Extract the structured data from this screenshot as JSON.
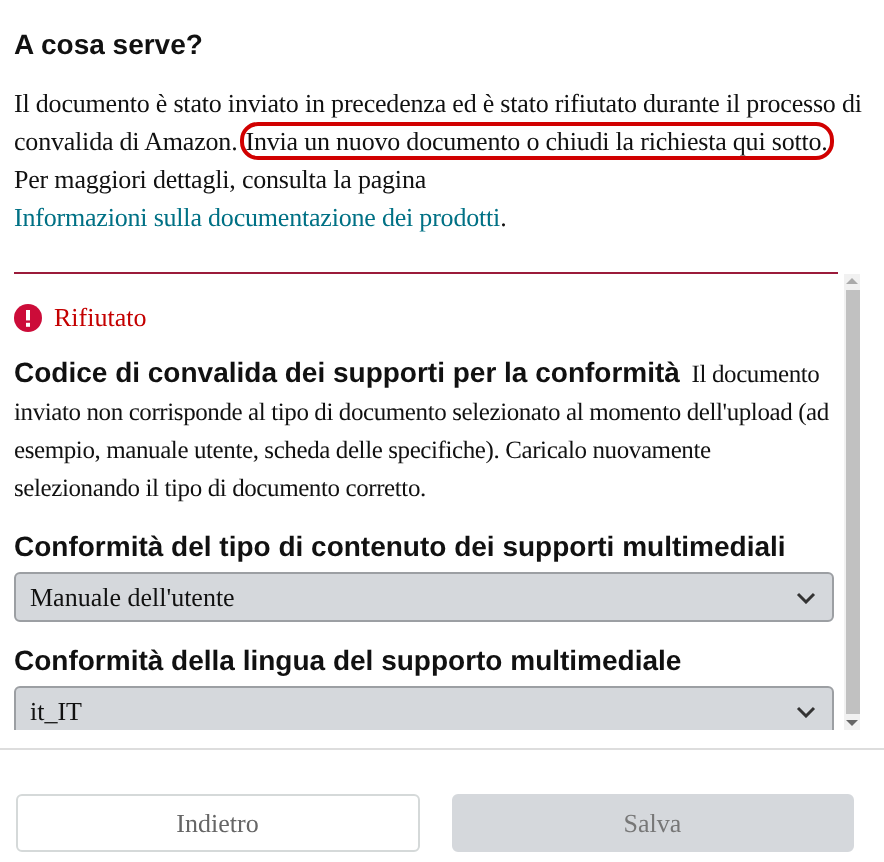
{
  "heading": "A cosa serve?",
  "intro": [
    {
      "kind": "text",
      "text": "Il documento è stato inviato in precedenza ed è stato rifiutato durante il processo di convalida di Amazon."
    },
    {
      "kind": "circled",
      "text": "Invia un nuovo documento o chiudi la richiesta qui sotto."
    },
    {
      "kind": "text",
      "text": " Per maggiori dettagli, consulta la pagina "
    },
    {
      "kind": "link",
      "text": "Informazioni sulla documentazione dei prodotti"
    },
    {
      "kind": "text",
      "text": "."
    }
  ],
  "status": {
    "kind": "error",
    "label": "Rifiutato"
  },
  "reason": {
    "text": "**Codice di convalida dei supporti per la conformità**  Il documento inviato non corrisponde al tipo di documento selezionato al momento dell'upload (ad esempio, manuale utente, scheda delle specifiche). Caricalo nuovamente selezionando il tipo di documento corretto."
  },
  "fields": [
    {
      "label": "Conformità del tipo di contenuto dei supporti multimediali",
      "value": "Manuale dell'utente"
    },
    {
      "label": "Conformità della lingua del supporto multimediale",
      "value": "it_IT"
    }
  ],
  "buttons": [
    {
      "label": "Indietro",
      "disabled": false
    },
    {
      "label": "Salva",
      "disabled": true
    }
  ]
}
